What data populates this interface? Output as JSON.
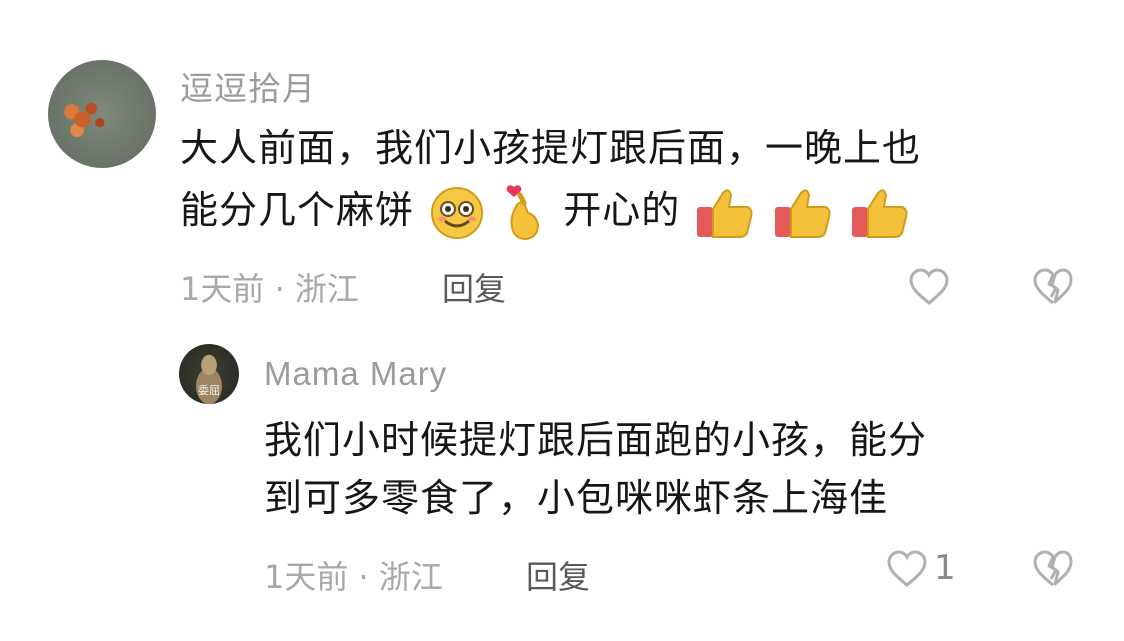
{
  "comments": [
    {
      "username": "逗逗拾月",
      "line1": "大人前面，我们小孩提灯跟后面，一晚上也",
      "line2_a": "能分几个麻饼",
      "line2_b": "开心的",
      "emojis": [
        "smiling-face-emoji",
        "finger-heart-emoji",
        "thumbs-up-emoji",
        "thumbs-up-emoji",
        "thumbs-up-emoji"
      ],
      "meta": "1天前 · 浙江",
      "reply_label": "回复",
      "like_count": ""
    },
    {
      "username": "Mama Mary",
      "avatar_caption": "委屈",
      "line1": "我们小时候提灯跟后面跑的小孩，能分",
      "line2": "到可多零食了，小包咪咪虾条上海佳",
      "meta": "1天前 · 浙江",
      "reply_label": "回复",
      "like_count": "1"
    }
  ],
  "colors": {
    "username": "#9b9b9b",
    "text": "#161616",
    "meta": "#a8a8a8",
    "reply": "#5a5a5a",
    "icon": "#b0b0b0"
  }
}
